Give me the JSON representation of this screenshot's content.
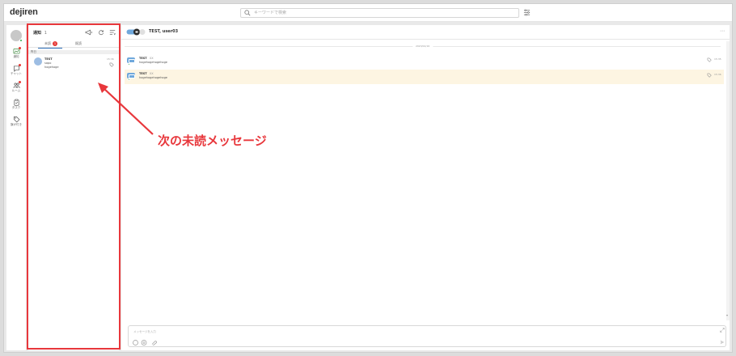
{
  "app": {
    "logo": "dejiren"
  },
  "search": {
    "placeholder": "キーワードで検索"
  },
  "nav": {
    "items": [
      {
        "label": "通知",
        "icon": "bell-chart-icon",
        "badge": true
      },
      {
        "label": "チャット",
        "icon": "chat-icon",
        "badge": true
      },
      {
        "label": "ルーム",
        "icon": "room-icon",
        "badge": true
      },
      {
        "label": "タスク",
        "icon": "clipboard-icon",
        "badge": false
      },
      {
        "label": "旗が付き",
        "icon": "tag-icon",
        "badge": false
      }
    ]
  },
  "notifications": {
    "title": "通知",
    "count": "1",
    "tabs": [
      {
        "label": "未読",
        "badge": "1"
      },
      {
        "label": "既読"
      }
    ],
    "section": "昨日",
    "items": [
      {
        "title": "TEST",
        "subtitle": "sapo",
        "preview": "hogehoge",
        "time": "15:36"
      }
    ]
  },
  "chat": {
    "title": "TEST, user03",
    "date": "2023/02/16",
    "messages": [
      {
        "name": "TEST",
        "sender_suffix": "XX",
        "text": "hogehogehogehoge",
        "time": "15:35",
        "highlighted": false
      },
      {
        "name": "TEST",
        "sender_suffix": "XX",
        "text": "hogehogehogehoge",
        "time": "15:36",
        "highlighted": true
      }
    ],
    "composer_placeholder": "メッセージを入力"
  },
  "annotation": {
    "text": "次の未読メッセージ",
    "color": "#e8373c"
  }
}
